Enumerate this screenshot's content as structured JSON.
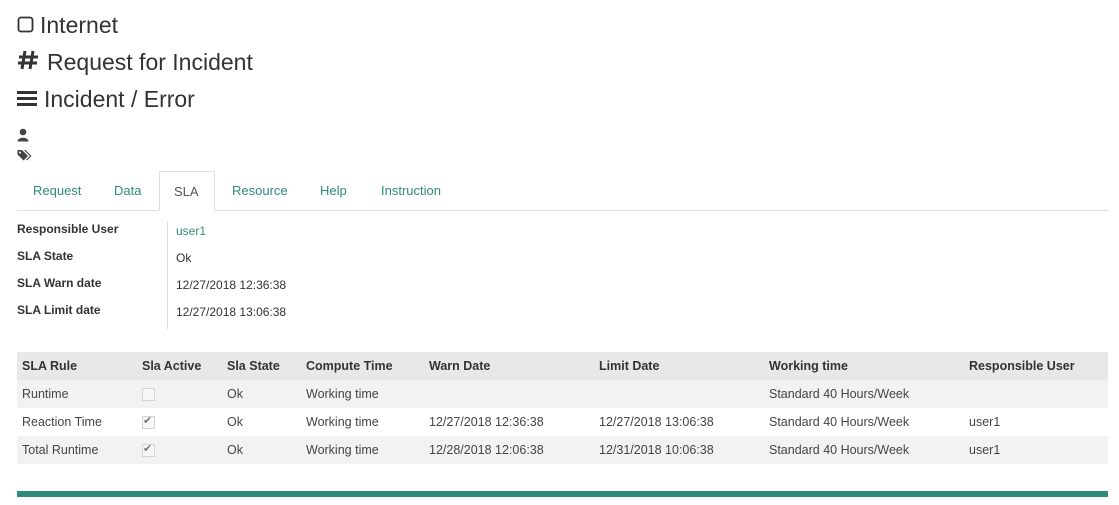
{
  "header": {
    "service": "Internet",
    "service_icon": "square-outline-icon",
    "request_type": "Request for Incident",
    "request_type_icon": "hash-icon",
    "category": "Incident / Error",
    "category_icon": "bars-icon",
    "user_icon": "user-icon",
    "tags_icon": "tags-icon"
  },
  "tabs": {
    "request": "Request",
    "data": "Data",
    "sla": "SLA",
    "resource": "Resource",
    "help": "Help",
    "instruction": "Instruction",
    "active": "SLA"
  },
  "info": {
    "responsible_user_label": "Responsible User",
    "responsible_user_value": "user1",
    "sla_state_label": "SLA State",
    "sla_state_value": "Ok",
    "warn_date_label": "SLA Warn date",
    "warn_date_value": "12/27/2018 12:36:38",
    "limit_date_label": "SLA Limit date",
    "limit_date_value": "12/27/2018 13:06:38"
  },
  "sla_table": {
    "headers": [
      "SLA Rule",
      "Sla Active",
      "Sla State",
      "Compute Time",
      "Warn Date",
      "Limit Date",
      "Working time",
      "Responsible User"
    ],
    "rows": [
      {
        "rule": "Runtime",
        "active": false,
        "state": "Ok",
        "compute_time": "Working time",
        "warn_date": "",
        "limit_date": "",
        "working_time": "Standard 40 Hours/Week",
        "responsible_user": ""
      },
      {
        "rule": "Reaction Time",
        "active": true,
        "state": "Ok",
        "compute_time": "Working time",
        "warn_date": "12/27/2018 12:36:38",
        "limit_date": "12/27/2018 13:06:38",
        "working_time": "Standard 40 Hours/Week",
        "responsible_user": "user1"
      },
      {
        "rule": "Total Runtime",
        "active": true,
        "state": "Ok",
        "compute_time": "Working time",
        "warn_date": "12/28/2018 12:06:38",
        "limit_date": "12/31/2018 10:06:38",
        "working_time": "Standard 40 Hours/Week",
        "responsible_user": "user1"
      }
    ],
    "check_mark": "✔"
  },
  "colors": {
    "accent": "#2e8b7a",
    "header_bg": "#e8e8e8",
    "row_alt_bg": "#f2f2f2"
  }
}
